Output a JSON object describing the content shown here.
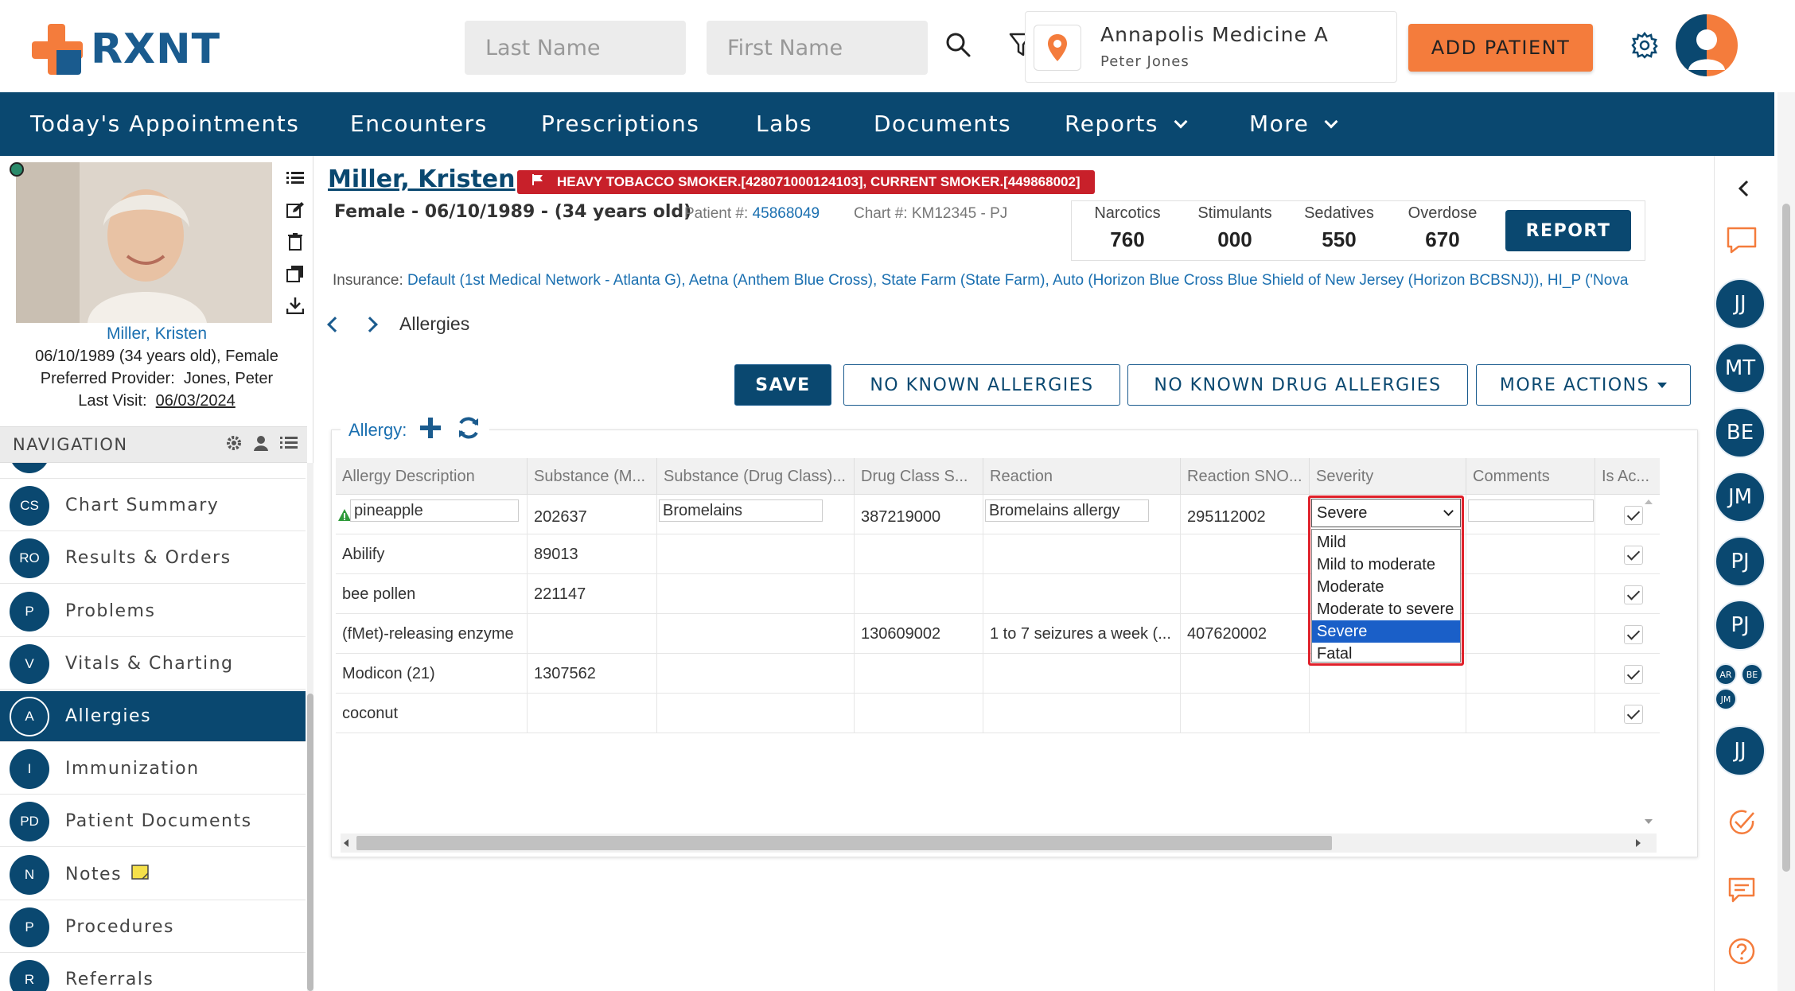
{
  "header": {
    "logo_text": "RXNT",
    "last_name_placeholder": "Last Name",
    "first_name_placeholder": "First Name",
    "location_name": "Annapolis Medicine A",
    "location_user": "Peter Jones",
    "add_patient_label": "ADD PATIENT"
  },
  "nav": {
    "items": [
      "Today's Appointments",
      "Encounters",
      "Prescriptions",
      "Labs",
      "Documents",
      "Reports",
      "More"
    ]
  },
  "patient_card": {
    "name": "Miller, Kristen",
    "dob_line": "06/10/1989 (34 years old), Female",
    "provider_label": "Preferred Provider:",
    "provider_value": "Jones, Peter",
    "last_visit_label": "Last Visit:",
    "last_visit_value": "06/03/2024"
  },
  "navigation": {
    "title": "NAVIGATION",
    "items": [
      {
        "badge": "CS",
        "label": "Chart Summary"
      },
      {
        "badge": "RO",
        "label": "Results & Orders"
      },
      {
        "badge": "P",
        "label": "Problems"
      },
      {
        "badge": "V",
        "label": "Vitals & Charting"
      },
      {
        "badge": "A",
        "label": "Allergies"
      },
      {
        "badge": "I",
        "label": "Immunization"
      },
      {
        "badge": "PD",
        "label": "Patient Documents"
      },
      {
        "badge": "N",
        "label": "Notes"
      },
      {
        "badge": "P",
        "label": "Procedures"
      },
      {
        "badge": "R",
        "label": "Referrals"
      }
    ],
    "active": "Allergies"
  },
  "patient_header": {
    "name": "Miller, Kristen",
    "alert": "HEAVY TOBACCO SMOKER.[428071000124103], CURRENT SMOKER.[449868002]",
    "demographics": "Female - 06/10/1989 - (34 years old)",
    "patient_num_label": "Patient #:",
    "patient_num": "45868049",
    "chart_num": "Chart #: KM12345 - PJ",
    "insurance_label": "Insurance:",
    "insurance_value": "Default (1st Medical Network - Atlanta G), Aetna (Anthem Blue Cross), State Farm (State Farm), Auto (Horizon Blue Cross Blue Shield of New Jersey (Horizon BCBSNJ)), HI_P ('Nova"
  },
  "pdmp": {
    "narcotics_label": "Narcotics",
    "narcotics": "760",
    "stimulants_label": "Stimulants",
    "stimulants": "000",
    "sedatives_label": "Sedatives",
    "sedatives": "550",
    "overdose_label": "Overdose",
    "overdose": "670",
    "report_label": "REPORT"
  },
  "page": {
    "section_title": "Allergies",
    "save_label": "SAVE",
    "nka_label": "NO KNOWN ALLERGIES",
    "nkda_label": "NO KNOWN DRUG ALLERGIES",
    "more_actions_label": "MORE ACTIONS",
    "allergy_label": "Allergy:"
  },
  "grid": {
    "columns": [
      "Allergy Description",
      "Substance (M...",
      "Substance (Drug Class)...",
      "Drug Class S...",
      "Reaction",
      "Reaction SNO...",
      "Severity",
      "Comments",
      "Is Ac..."
    ],
    "rows": [
      {
        "desc": "pineapple",
        "substance": "202637",
        "drug_class": "Bromelains",
        "drug_class_s": "387219000",
        "reaction": "Bromelains allergy",
        "reaction_sno": "295112002",
        "severity": "Severe",
        "comments": "",
        "active": true
      },
      {
        "desc": "Abilify",
        "substance": "89013",
        "drug_class": "",
        "drug_class_s": "",
        "reaction": "",
        "reaction_sno": "",
        "severity": "",
        "comments": "",
        "active": true
      },
      {
        "desc": "bee pollen",
        "substance": "221147",
        "drug_class": "",
        "drug_class_s": "",
        "reaction": "",
        "reaction_sno": "",
        "severity": "",
        "comments": "",
        "active": true
      },
      {
        "desc": "(fMet)-releasing enzyme",
        "substance": "",
        "drug_class": "",
        "drug_class_s": "130609002",
        "reaction": "1 to 7 seizures a week (...",
        "reaction_sno": "407620002",
        "severity": "",
        "comments": "",
        "active": true
      },
      {
        "desc": "Modicon (21)",
        "substance": "1307562",
        "drug_class": "",
        "drug_class_s": "",
        "reaction": "",
        "reaction_sno": "",
        "severity": "",
        "comments": "",
        "active": true
      },
      {
        "desc": "coconut",
        "substance": "",
        "drug_class": "",
        "drug_class_s": "",
        "reaction": "",
        "reaction_sno": "",
        "severity": "",
        "comments": "",
        "active": true
      }
    ],
    "severity_options": [
      "Mild",
      "Mild to moderate",
      "Moderate",
      "Moderate to severe",
      "Severe",
      "Fatal"
    ],
    "severity_selected": "Severe"
  },
  "right_rail": {
    "users": [
      "JJ",
      "MT",
      "BE",
      "JM",
      "PJ",
      "PJ"
    ],
    "small_users": [
      "AR",
      "BE",
      "JM"
    ],
    "bottom_user": "JJ"
  },
  "colors": {
    "brand_navy": "#0a4870",
    "brand_orange": "#f47c3c",
    "alert_red": "#c8202a",
    "selection_blue": "#1a5fc8"
  }
}
